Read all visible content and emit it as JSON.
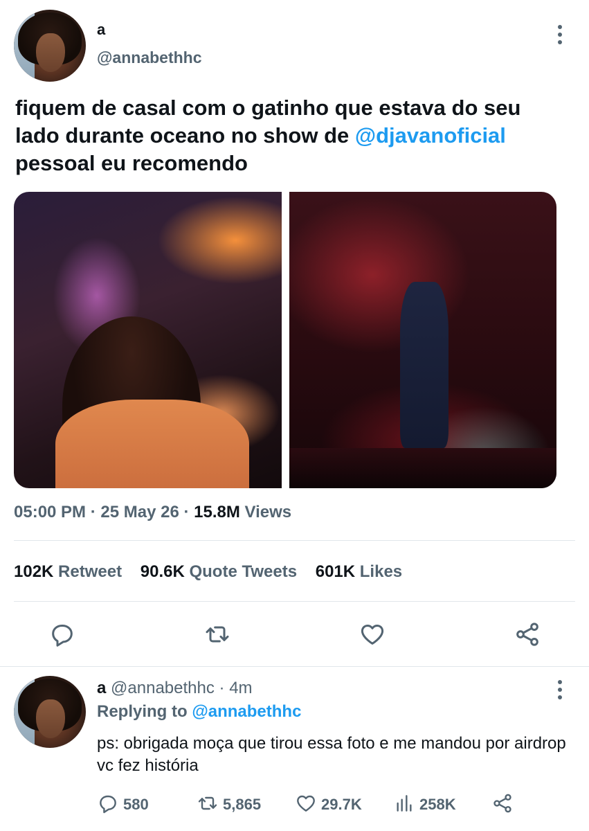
{
  "tweet": {
    "author_name": "a",
    "author_handle": "@annabethhc",
    "text_before": "fiquem de casal com o gatinho que estava do seu lado durante oceano no show de ",
    "mention": "@djavanoficial",
    "text_after": " pessoal eu recomendo",
    "time": "05:00 PM",
    "date": "25 May 26",
    "views_count": "15.8M",
    "views_label": "Views",
    "stats": {
      "retweets_count": "102K",
      "retweets_label": "Retweet",
      "quotes_count": "90.6K",
      "quotes_label": "Quote Tweets",
      "likes_count": "601K",
      "likes_label": "Likes"
    }
  },
  "reply": {
    "author_name": "a",
    "author_handle": "@annabethhc",
    "age": "4m",
    "replying_to_label": "Replying to",
    "replying_to_handle": "@annabethhc",
    "text": "ps: obrigada moça que tirou essa foto e me mandou por airdrop vc fez história",
    "counts": {
      "replies": "580",
      "retweets": "5,865",
      "likes": "29.7K",
      "views": "258K"
    }
  },
  "icons": [
    "more-icon",
    "reply-icon",
    "retweet-icon",
    "like-icon",
    "share-icon",
    "views-icon"
  ],
  "colors": {
    "accent": "#1d9bf0",
    "secondary_text": "#536471",
    "primary_text": "#0f1419"
  }
}
